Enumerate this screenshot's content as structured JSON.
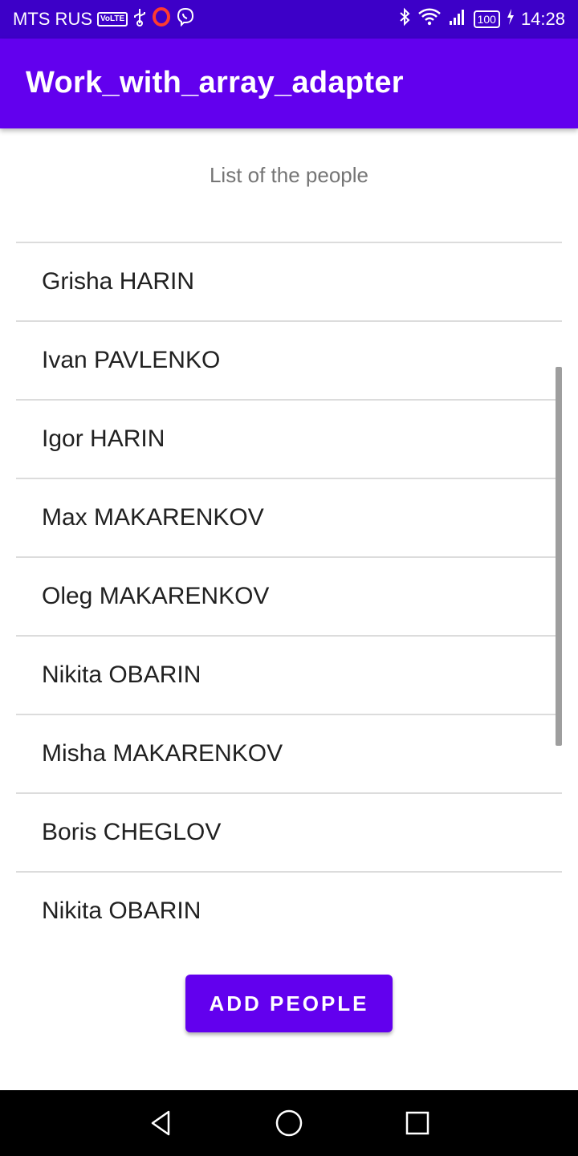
{
  "status_bar": {
    "carrier": "MTS RUS",
    "volte": "VoLTE",
    "battery": "100",
    "time": "14:28",
    "icons": [
      "usb-icon",
      "opera-icon",
      "viber-icon",
      "bluetooth-icon",
      "wifi-icon",
      "signal-icon",
      "battery-icon",
      "charging-icon"
    ]
  },
  "app_bar": {
    "title": "Work_with_array_adapter",
    "color": "#6200ee"
  },
  "main": {
    "heading": "List of the people",
    "people": [
      "Grisha HARIN",
      "Ivan PAVLENKO",
      "Igor HARIN",
      "Max MAKARENKOV",
      "Oleg MAKARENKOV",
      "Nikita OBARIN",
      "Misha MAKARENKOV",
      "Boris CHEGLOV",
      "Nikita OBARIN"
    ],
    "add_button_label": "ADD PEOPLE"
  },
  "nav_bar": {
    "icons": [
      "back-icon",
      "home-icon",
      "recents-icon"
    ]
  }
}
